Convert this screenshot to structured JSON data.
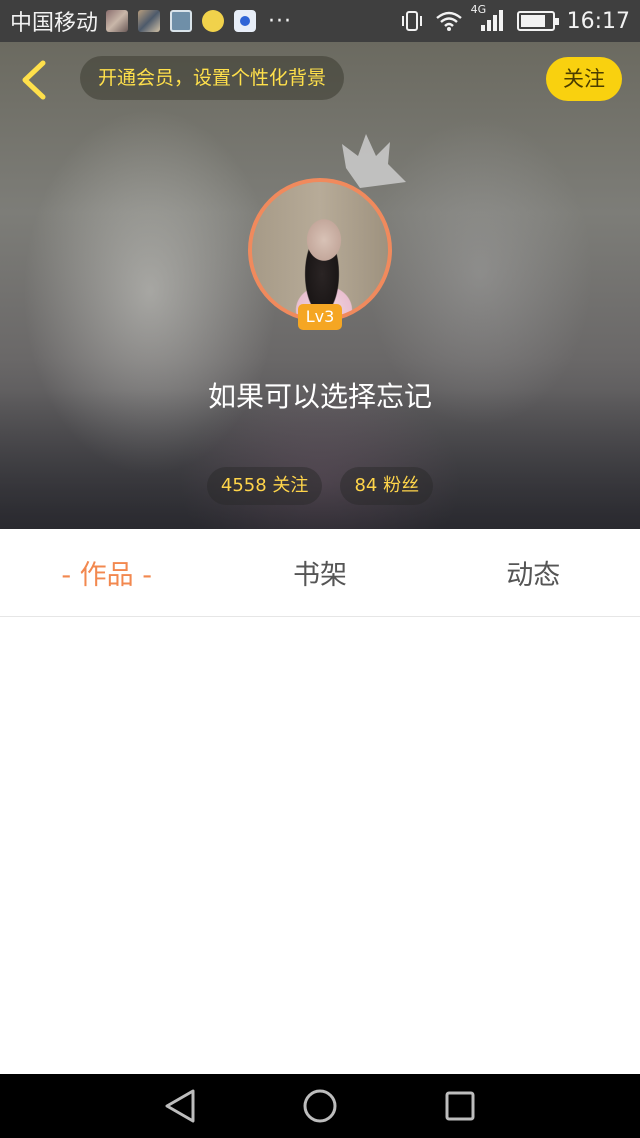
{
  "status_bar": {
    "carrier": "中国移动",
    "more": "···",
    "network": "4G",
    "time": "16:17"
  },
  "header": {
    "vip_banner": "开通会员，设置个性化背景",
    "follow_label": "关注"
  },
  "profile": {
    "level_badge": "Lv3",
    "nickname": "如果可以选择忘记",
    "following": "4558 关注",
    "followers": "84 粉丝"
  },
  "tabs": [
    {
      "label": "- 作品 -",
      "active": true
    },
    {
      "label": "书架",
      "active": false
    },
    {
      "label": "动态",
      "active": false
    }
  ],
  "colors": {
    "accent_orange": "#f2884f",
    "follow_yellow": "#f9d10f",
    "stat_yellow": "#ffd54a",
    "level_orange": "#f5a623"
  },
  "icons": {
    "back": "chevron-left-icon",
    "crown": "crown-icon",
    "nav_back": "triangle-back-icon",
    "nav_home": "circle-home-icon",
    "nav_recents": "square-recents-icon"
  }
}
